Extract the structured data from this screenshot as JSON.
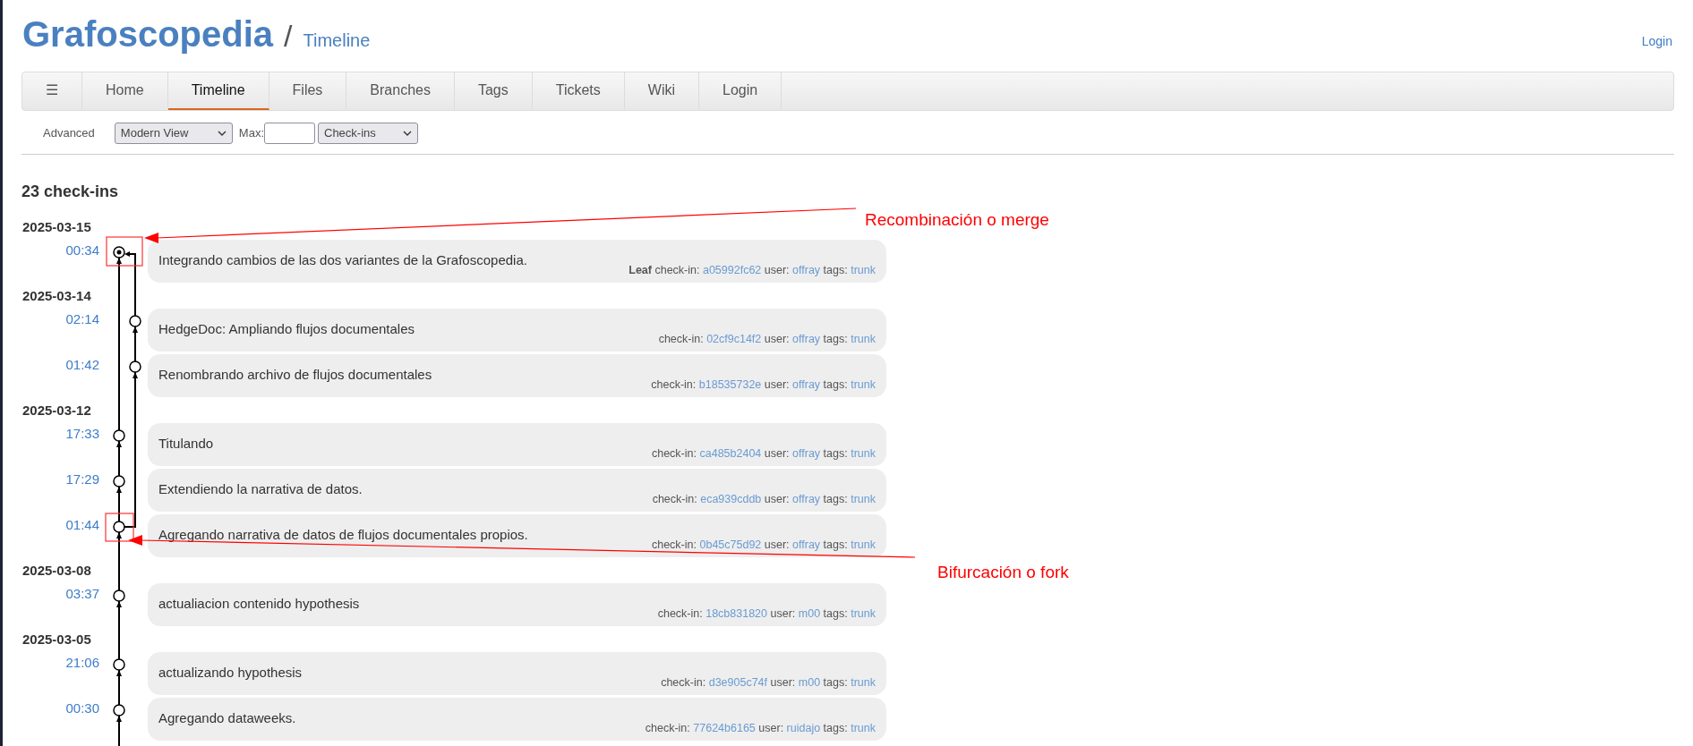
{
  "header": {
    "project": "Grafoscopedia",
    "separator": "/",
    "page": "Timeline",
    "login": "Login"
  },
  "nav": [
    {
      "label": "☰",
      "selected": false
    },
    {
      "label": "Home",
      "selected": false
    },
    {
      "label": "Timeline",
      "selected": true
    },
    {
      "label": "Files",
      "selected": false
    },
    {
      "label": "Branches",
      "selected": false
    },
    {
      "label": "Tags",
      "selected": false
    },
    {
      "label": "Tickets",
      "selected": false
    },
    {
      "label": "Wiki",
      "selected": false
    },
    {
      "label": "Login",
      "selected": false
    }
  ],
  "filters": {
    "advanced": "Advanced",
    "view": "Modern View",
    "max_label": "Max:",
    "type": "Check-ins"
  },
  "count": "23 check-ins",
  "days": [
    {
      "date": "2025-03-15",
      "entries": [
        {
          "time": "00:34",
          "kind": "merge",
          "comment": "Integrando cambios de las dos variantes de la Grafoscopedia.",
          "flag": "Leaf",
          "check_in_label": "check-in:",
          "hash": "a05992fc62",
          "user_label": "user:",
          "user": "offray",
          "tags_label": "tags:",
          "tag": "trunk"
        }
      ]
    },
    {
      "date": "2025-03-14",
      "entries": [
        {
          "time": "02:14",
          "kind": "commit",
          "comment": "HedgeDoc: Ampliando flujos documentales",
          "check_in_label": "check-in:",
          "hash": "02cf9c14f2",
          "user_label": "user:",
          "user": "offray",
          "tags_label": "tags:",
          "tag": "trunk"
        },
        {
          "time": "01:42",
          "kind": "commit",
          "comment": "Renombrando archivo de flujos documentales",
          "check_in_label": "check-in:",
          "hash": "b18535732e",
          "user_label": "user:",
          "user": "offray",
          "tags_label": "tags:",
          "tag": "trunk"
        }
      ]
    },
    {
      "date": "2025-03-12",
      "entries": [
        {
          "time": "17:33",
          "kind": "commit",
          "comment": "Titulando",
          "check_in_label": "check-in:",
          "hash": "ca485b2404",
          "user_label": "user:",
          "user": "offray",
          "tags_label": "tags:",
          "tag": "trunk"
        },
        {
          "time": "17:29",
          "kind": "commit",
          "comment": "Extendiendo la narrativa de datos.",
          "check_in_label": "check-in:",
          "hash": "eca939cddb",
          "user_label": "user:",
          "user": "offray",
          "tags_label": "tags:",
          "tag": "trunk"
        },
        {
          "time": "01:44",
          "kind": "fork",
          "comment": "Agregando narrativa de datos de flujos documentales propios.",
          "check_in_label": "check-in:",
          "hash": "0b45c75d92",
          "user_label": "user:",
          "user": "offray",
          "tags_label": "tags:",
          "tag": "trunk"
        }
      ]
    },
    {
      "date": "2025-03-08",
      "entries": [
        {
          "time": "03:37",
          "kind": "commit",
          "comment": "actualiacion contenido hypothesis",
          "check_in_label": "check-in:",
          "hash": "18cb831820",
          "user_label": "user:",
          "user": "m00",
          "tags_label": "tags:",
          "tag": "trunk"
        }
      ]
    },
    {
      "date": "2025-03-05",
      "entries": [
        {
          "time": "21:06",
          "kind": "commit",
          "comment": "actualizando hypothesis",
          "check_in_label": "check-in:",
          "hash": "d3e905c74f",
          "user_label": "user:",
          "user": "m00",
          "tags_label": "tags:",
          "tag": "trunk"
        },
        {
          "time": "00:30",
          "kind": "commit",
          "comment": "Agregando dataweeks.",
          "check_in_label": "check-in:",
          "hash": "77624b6165",
          "user_label": "user:",
          "user": "ruidajo",
          "tags_label": "tags:",
          "tag": "trunk"
        }
      ]
    }
  ],
  "annotations": [
    {
      "text": "Recombinación o merge"
    },
    {
      "text": "Bifurcación o fork"
    }
  ]
}
